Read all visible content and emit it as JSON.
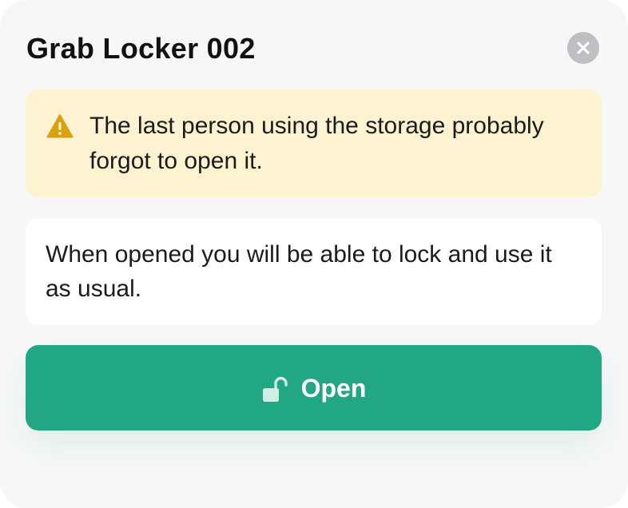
{
  "dialog": {
    "title": "Grab Locker 002",
    "close_icon": "close-icon"
  },
  "warning": {
    "icon": "warning-triangle-icon",
    "message": "The last person using the storage probably forgot to open it."
  },
  "info": {
    "message": "When opened you will be able to lock and use it as usual."
  },
  "actions": {
    "open_label": "Open",
    "open_icon": "unlock-icon"
  },
  "colors": {
    "accent": "#21a783",
    "warning_bg": "#fdf3d0",
    "warning_icon": "#d9a012"
  }
}
